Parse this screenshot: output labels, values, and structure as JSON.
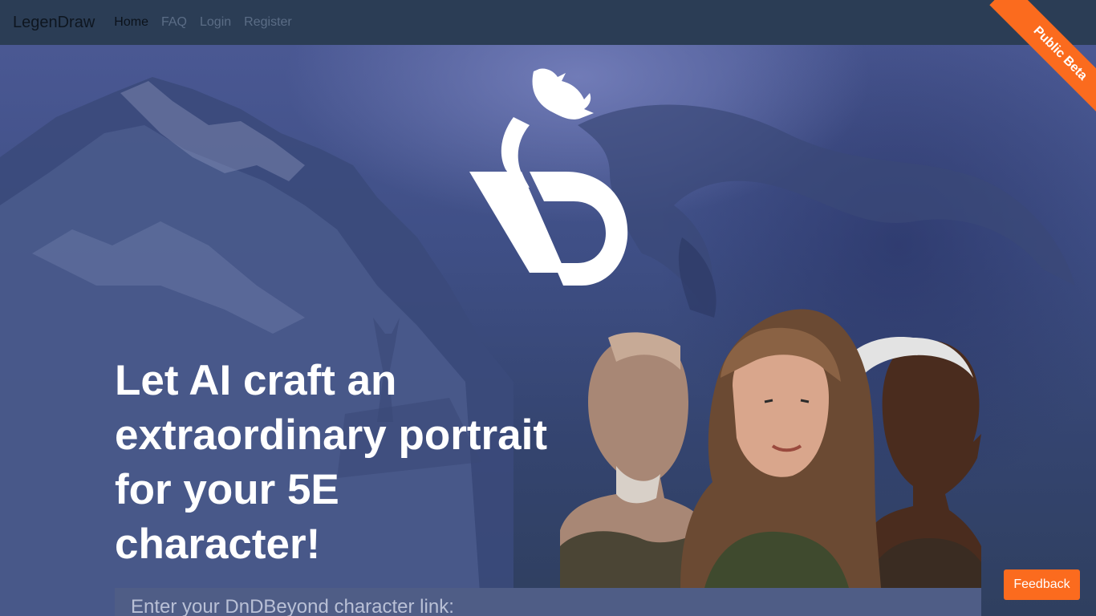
{
  "navbar": {
    "brand": "LegenDraw",
    "links": [
      {
        "label": "Home",
        "active": true
      },
      {
        "label": "FAQ",
        "active": false
      },
      {
        "label": "Login",
        "active": false
      },
      {
        "label": "Register",
        "active": false
      }
    ]
  },
  "ribbon": {
    "label": "Public Beta",
    "color": "#fb6b1e"
  },
  "hero": {
    "headline": "Let AI craft an extraordinary portrait for your 5E character!",
    "logo_icon": "dragon-ld-logo",
    "portraits_icon": "character-portraits"
  },
  "search": {
    "placeholder": "Enter your DnDBeyond character link:",
    "value": ""
  },
  "feedback": {
    "label": "Feedback"
  },
  "colors": {
    "accent": "#fb6b1e",
    "navbar": "#2b3d55",
    "hero_bg": "#3f4f86"
  }
}
